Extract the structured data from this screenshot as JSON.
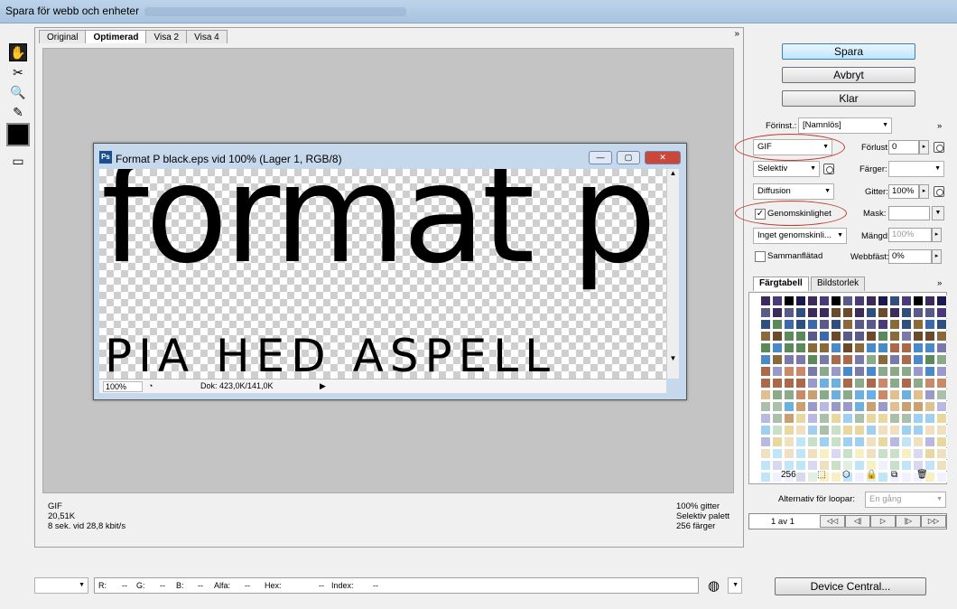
{
  "window": {
    "title": "Spara för webb och enheter"
  },
  "tabs": [
    "Original",
    "Optimerad",
    "Visa 2",
    "Visa 4"
  ],
  "document": {
    "title": "Format P black.eps vid 100% (Lager 1, RGB/8)",
    "big_text": "format p",
    "small_text": "PIA HED ASPELL",
    "zoom": "100%",
    "doc_size": "Dok: 423,0K/141,0K",
    "min": "—",
    "max": "▢",
    "close": "✕",
    "scroll_up": "▲",
    "scroll_down": "▼",
    "scroll_right": "▶",
    "nav_icon": "◔"
  },
  "info_left": [
    "GIF",
    "20,51K",
    "8 sek. vid 28,8 kbit/s"
  ],
  "info_right": [
    "100% gitter",
    "Selektiv palett",
    "256 färger"
  ],
  "buttons": {
    "save": "Spara",
    "cancel": "Avbryt",
    "done": "Klar",
    "device_central": "Device Central..."
  },
  "settings": {
    "preset_label": "Förinst.:",
    "preset_value": "[Namnlös]",
    "format": "GIF",
    "loss_label": "Förlust:",
    "loss_value": "0",
    "palette": "Selektiv",
    "colors_label": "Färger:",
    "dither_type": "Diffusion",
    "dither_label": "Gitter:",
    "dither_value": "100%",
    "transparency_label": "Genomskinlighet",
    "transparency_checked": true,
    "matte_label": "Mask:",
    "trans_dither": "Inget genomskinli...",
    "amount_label": "Mängd:",
    "amount_value": "100%",
    "interlaced_label": "Sammanflätad",
    "websnap_label": "Webbfäst:",
    "websnap_value": "0%",
    "arrow": "▸",
    "check": "✓"
  },
  "color_tabs": [
    "Färgtabell",
    "Bildstorlek"
  ],
  "color_count": "256",
  "loop": {
    "label": "Alternativ för loopar:",
    "value": "En gång",
    "frame": "1 av 1",
    "buttons": [
      "◁◁",
      "◁|",
      "▷",
      "|▷",
      "▷▷"
    ]
  },
  "readout": {
    "r": "R:",
    "g": "G:",
    "b": "B:",
    "alpha": "Alfa:",
    "hex": "Hex:",
    "index": "Index:",
    "dash": "--"
  },
  "icons": {
    "hand": "✋",
    "slice": "✂",
    "zoom": "🔍",
    "eyedropper": "✎",
    "toggle": "▭",
    "menu": "»",
    "browser": "◍"
  }
}
